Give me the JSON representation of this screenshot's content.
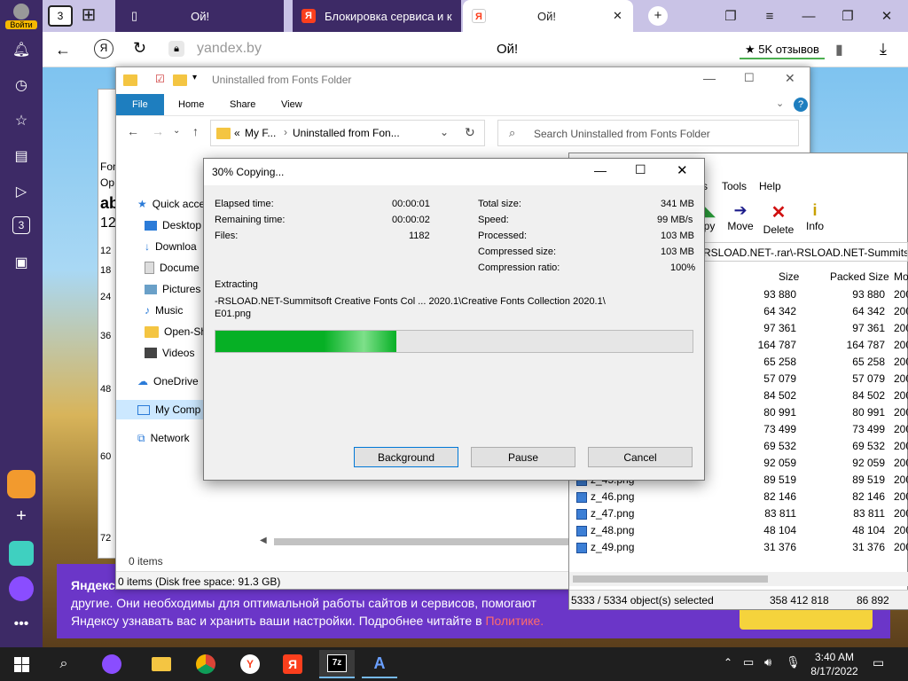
{
  "browser": {
    "login_label": "Войти",
    "tab_count": "3",
    "tabs": [
      {
        "title": "Ой!"
      },
      {
        "title": "Блокировка сервиса и к"
      },
      {
        "title": "Ой!"
      }
    ],
    "address": "yandex.by",
    "page_title": "Ой!",
    "reviews_label": "5K отзывов",
    "sidebar_badge": "3"
  },
  "explorer": {
    "title": "Uninstalled from Fonts Folder",
    "ribbon_tabs": [
      "File",
      "Home",
      "Share",
      "View"
    ],
    "breadcrumb_prefix": "«",
    "breadcrumb_1": "My F...",
    "breadcrumb_2": "Uninstalled from Fon...",
    "search_placeholder": "Search Uninstalled from Fonts Folder",
    "nav_items": [
      {
        "label": "Quick acce"
      },
      {
        "label": "Desktop"
      },
      {
        "label": "Downloa"
      },
      {
        "label": "Docume"
      },
      {
        "label": "Pictures"
      },
      {
        "label": "Music"
      },
      {
        "label": "Open-Sh"
      },
      {
        "label": "Videos"
      },
      {
        "label": "OneDrive"
      },
      {
        "label": "My Comp"
      },
      {
        "label": "Network"
      }
    ],
    "items_count": "0 items",
    "status": "0 items (Disk free space: 91.3 GB)",
    "left_numbers": [
      "Fon",
      "Op",
      "ab",
      "12",
      "12",
      "18",
      "24",
      "36",
      "48",
      "60",
      "72"
    ]
  },
  "sevenzip": {
    "menu": [
      "s",
      "Tools",
      "Help"
    ],
    "tools": [
      {
        "label": "py"
      },
      {
        "label": "Move"
      },
      {
        "label": "Delete"
      },
      {
        "label": "Info"
      }
    ],
    "path": "RSLOAD.NET-.rar\\-RSLOAD.NET-Summitsoft",
    "columns": [
      "Size",
      "Packed Size",
      "Mo"
    ],
    "rows": [
      {
        "name": "",
        "size": "93 880",
        "packed": "93 880",
        "mod": "200"
      },
      {
        "name": "",
        "size": "64 342",
        "packed": "64 342",
        "mod": "200"
      },
      {
        "name": "",
        "size": "97 361",
        "packed": "97 361",
        "mod": "200"
      },
      {
        "name": "",
        "size": "164 787",
        "packed": "164 787",
        "mod": "200"
      },
      {
        "name": "",
        "size": "65 258",
        "packed": "65 258",
        "mod": "200"
      },
      {
        "name": "",
        "size": "57 079",
        "packed": "57 079",
        "mod": "200"
      },
      {
        "name": "",
        "size": "84 502",
        "packed": "84 502",
        "mod": "200"
      },
      {
        "name": "",
        "size": "80 991",
        "packed": "80 991",
        "mod": "200"
      },
      {
        "name": "",
        "size": "73 499",
        "packed": "73 499",
        "mod": "200"
      },
      {
        "name": "",
        "size": "69 532",
        "packed": "69 532",
        "mod": "200"
      },
      {
        "name": "",
        "size": "92 059",
        "packed": "92 059",
        "mod": "200"
      },
      {
        "name": "z_45.png",
        "size": "89 519",
        "packed": "89 519",
        "mod": "200"
      },
      {
        "name": "z_46.png",
        "size": "82 146",
        "packed": "82 146",
        "mod": "200"
      },
      {
        "name": "z_47.png",
        "size": "83 811",
        "packed": "83 811",
        "mod": "200"
      },
      {
        "name": "z_48.png",
        "size": "48 104",
        "packed": "48 104",
        "mod": "200"
      },
      {
        "name": "z_49.png",
        "size": "31 376",
        "packed": "31 376",
        "mod": "200"
      }
    ],
    "status_selected": "5333 / 5334 object(s) selected",
    "status_size": "358 412 818",
    "status_packed": "86 892"
  },
  "dialog": {
    "title": "30% Copying...",
    "elapsed_label": "Elapsed time:",
    "elapsed": "00:00:01",
    "remaining_label": "Remaining time:",
    "remaining": "00:00:02",
    "files_label": "Files:",
    "files": "1182",
    "total_label": "Total size:",
    "total": "341 MB",
    "speed_label": "Speed:",
    "speed": "99 MB/s",
    "processed_label": "Processed:",
    "processed": "103 MB",
    "compressed_label": "Compressed size:",
    "compressed": "103 MB",
    "ratio_label": "Compression ratio:",
    "ratio": "100%",
    "action": "Extracting",
    "file_line1": "-RSLOAD.NET-Summitsoft Creative Fonts Col ...  2020.1\\Creative Fonts Collection 2020.1\\",
    "file_line2": "E01.png",
    "progress": 0.38,
    "background_label": "Background",
    "pause_label": "Pause",
    "cancel_label": "Cancel"
  },
  "banner": {
    "title": "Яндекс",
    "line1": "другие. Они необходимы для оптимальной работы сайтов и сервисов, помогают",
    "line2": "Яндексу узнавать вас и хранить ваши настройки. Подробнее читайте в",
    "link": "Политике."
  },
  "taskbar": {
    "time": "3:40 AM",
    "date": "8/17/2022"
  }
}
